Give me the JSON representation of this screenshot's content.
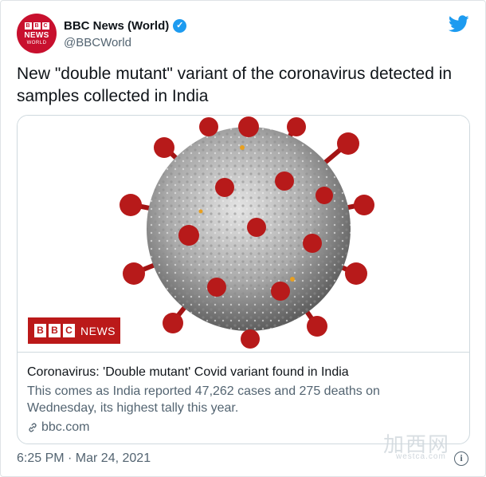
{
  "account": {
    "name": "BBC News (World)",
    "handle": "@BBCWorld",
    "avatar_blocks": [
      "B",
      "B",
      "C"
    ],
    "avatar_line1": "NEWS",
    "avatar_line2": "WORLD"
  },
  "tweet": {
    "text": "New \"double mutant\" variant of the coronavirus detected in samples collected in India",
    "timestamp": "6:25 PM · Mar 24, 2021"
  },
  "card": {
    "badge_letters": [
      "B",
      "B",
      "C"
    ],
    "badge_word": "NEWS",
    "title": "Coronavirus: 'Double mutant' Covid variant found in India",
    "description": "This comes as India reported 47,262 cases and 275 deaths on Wednesday, its highest tally this year.",
    "domain": "bbc.com"
  },
  "watermark": {
    "main": "加西网",
    "sub": "westca.com"
  },
  "colors": {
    "brand_red": "#bb1919",
    "twitter_blue": "#1d9bf0",
    "secondary_text": "#536471"
  },
  "icons": {
    "verified": "verified-badge-icon",
    "bird": "twitter-bird-icon",
    "link": "link-icon",
    "info": "info-icon"
  }
}
